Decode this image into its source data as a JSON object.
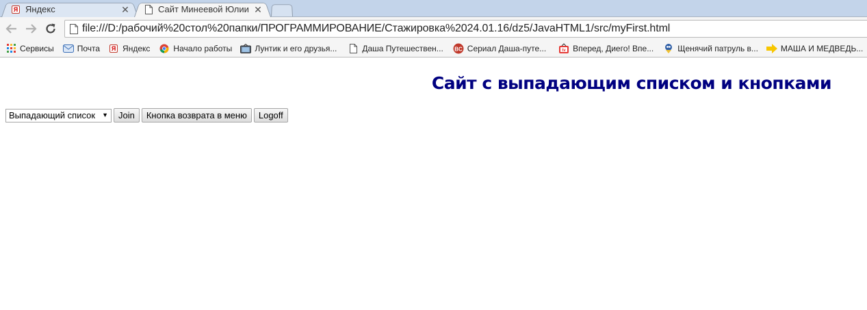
{
  "browser": {
    "tabs": [
      {
        "title": "Яндекс",
        "favicon": "yandex-icon",
        "active": false
      },
      {
        "title": "Сайт Минеевой Юлии",
        "favicon": "page-icon",
        "active": true
      }
    ],
    "url": "file:///D:/рабочий%20стол%20папки/ПРОГРАММИРОВАНИЕ/Стажировка%2024.01.16/dz5/JavaHTML1/src/myFirst.html",
    "bookmarks": [
      {
        "label": "Сервисы",
        "icon": "apps-grid-icon"
      },
      {
        "label": "Почта",
        "icon": "mail-icon"
      },
      {
        "label": "Яндекс",
        "icon": "yandex-icon"
      },
      {
        "label": "Начало работы",
        "icon": "chrome-icon"
      },
      {
        "label": "Лунтик и его друзья...",
        "icon": "tv-icon"
      },
      {
        "label": "Даша Путешествен...",
        "icon": "page-icon"
      },
      {
        "label": "Сериал Даша-путе...",
        "icon": "bc-icon"
      },
      {
        "label": "Вперед, Диего! Впе...",
        "icon": "tv-red-icon"
      },
      {
        "label": "Щенячий патруль в...",
        "icon": "cartoon-icon"
      },
      {
        "label": "МАША И МЕДВЕДЬ...",
        "icon": "arrow-right-icon"
      }
    ]
  },
  "page": {
    "heading": "Сайт с выпадающим списком и кнопками",
    "dropdown": {
      "selected": "Выпадающий список"
    },
    "buttons": {
      "join": "Join",
      "back_to_menu": "Кнопка возврата в меню",
      "logoff": "Logoff"
    }
  },
  "colors": {
    "heading": "#000080",
    "tabstrip": "#c3d4ea"
  }
}
